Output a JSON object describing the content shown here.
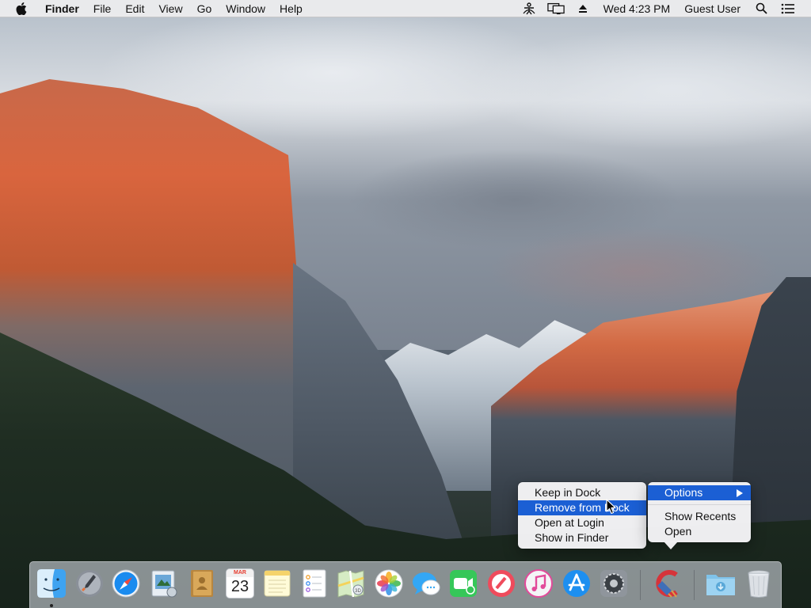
{
  "menubar": {
    "app_name": "Finder",
    "menus": [
      "File",
      "Edit",
      "View",
      "Go",
      "Window",
      "Help"
    ],
    "clock": "Wed 4:23 PM",
    "user": "Guest User",
    "icons": [
      "apple-icon",
      "accessibility-icon",
      "display-mirroring-icon",
      "eject-icon",
      "spotlight-search-icon",
      "notification-center-icon"
    ]
  },
  "context_menu": {
    "items": [
      "Keep in Dock",
      "Remove from Dock",
      "Open at Login",
      "Show in Finder"
    ],
    "highlighted": "Remove from Dock"
  },
  "sub_menu": {
    "options_label": "Options",
    "items": [
      "Show Recents",
      "Open"
    ]
  },
  "dock": {
    "calendar": {
      "month": "MAR",
      "day": "23"
    },
    "icons": [
      "finder-icon",
      "launchpad-icon",
      "safari-icon",
      "mail-icon",
      "contacts-icon",
      "calendar-icon",
      "notes-icon",
      "reminders-icon",
      "maps-icon",
      "photos-icon",
      "messages-icon",
      "facetime-icon",
      "news-icon",
      "itunes-icon",
      "app-store-icon",
      "system-preferences-icon",
      "ccleaner-icon",
      "downloads-folder-icon",
      "trash-icon"
    ],
    "colors": {
      "highlight": "#1b5fd4",
      "dock_bg": "#cdd2da"
    }
  }
}
